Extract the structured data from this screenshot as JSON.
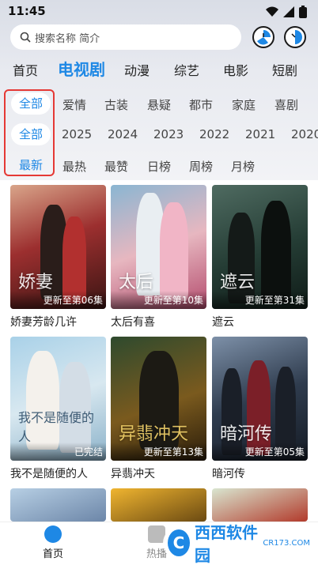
{
  "status_bar": {
    "time": "11:45"
  },
  "search": {
    "placeholder": "搜索名称 简介"
  },
  "main_tabs": [
    {
      "label": "首页"
    },
    {
      "label": "电视剧"
    },
    {
      "label": "动漫"
    },
    {
      "label": "综艺"
    },
    {
      "label": "电影"
    },
    {
      "label": "短剧"
    }
  ],
  "filters": {
    "genre": [
      "全部",
      "爱情",
      "古装",
      "悬疑",
      "都市",
      "家庭",
      "喜剧"
    ],
    "year": [
      "全部",
      "2025",
      "2024",
      "2023",
      "2022",
      "2021",
      "2020"
    ],
    "sort": [
      "最新",
      "最热",
      "最赞",
      "日榜",
      "周榜",
      "月榜"
    ]
  },
  "shows": [
    {
      "title": "娇妻芳龄几许",
      "status": "更新至第06集",
      "art_text": "娇妻"
    },
    {
      "title": "太后有喜",
      "status": "更新至第10集",
      "art_text": "太后"
    },
    {
      "title": "遮云",
      "status": "更新至第31集",
      "art_text": "遮云"
    },
    {
      "title": "我不是随便的人",
      "status": "已完结",
      "art_text": "我不是随便的人"
    },
    {
      "title": "异翡冲天",
      "status": "更新至第13集",
      "art_text": "异翡冲天"
    },
    {
      "title": "暗河传",
      "status": "更新至第05集",
      "art_text": "暗河传"
    }
  ],
  "bottom_nav": [
    {
      "label": "首页"
    },
    {
      "label": "热播"
    }
  ],
  "watermark": {
    "brand": "西西软件园",
    "sub": "CR173.COM"
  },
  "colors": {
    "accent": "#1e88e5",
    "highlight_box": "#e53935"
  }
}
